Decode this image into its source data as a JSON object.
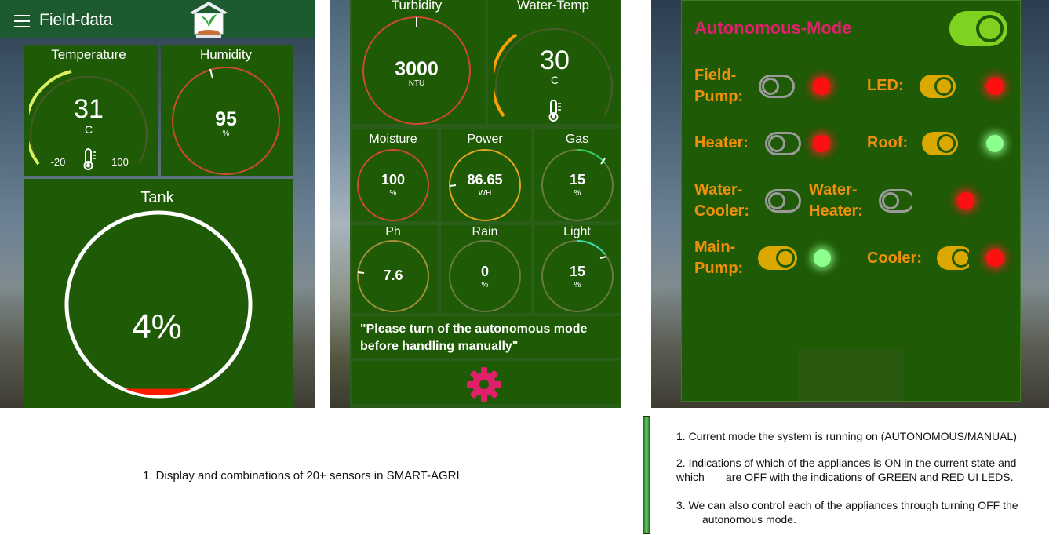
{
  "screen1": {
    "app_title": "Field-data",
    "temperature": {
      "label": "Temperature",
      "value": "31",
      "unit": "C",
      "min": "-20",
      "max": "100"
    },
    "humidity": {
      "label": "Humidity",
      "value": "95",
      "unit": "%"
    },
    "tank": {
      "label": "Tank",
      "value": "4%",
      "level": 0.04
    }
  },
  "screen2": {
    "turbidity": {
      "label": "Turbidity",
      "value": "3000",
      "unit": "NTU"
    },
    "water_temp": {
      "label": "Water-Temp",
      "value": "30",
      "unit": "C"
    },
    "moisture": {
      "label": "Moisture",
      "value": "100",
      "unit": "%"
    },
    "power": {
      "label": "Power",
      "value": "86.65",
      "unit": "WH"
    },
    "gas": {
      "label": "Gas",
      "value": "15",
      "unit": "%"
    },
    "ph": {
      "label": "Ph",
      "value": "7.6"
    },
    "rain": {
      "label": "Rain",
      "value": "0",
      "unit": "%"
    },
    "light": {
      "label": "Light",
      "value": "15",
      "unit": "%"
    },
    "notice": "\"Please turn of the autonomous mode before handling manually\"",
    "settings_icon": "gear-icon"
  },
  "screen3": {
    "autonomous_label": "Autonomous-Mode",
    "autonomous_on": true,
    "appliances": {
      "field_pump": {
        "label_1": "Field-",
        "label_2": "Pump:",
        "on": false,
        "led": "red"
      },
      "led": {
        "label": "LED:",
        "on": true,
        "led": "red"
      },
      "heater": {
        "label": "Heater:",
        "on": false,
        "led": "red"
      },
      "roof": {
        "label": "Roof:",
        "on": true,
        "led": "green"
      },
      "water_cooler": {
        "label_1": "Water-",
        "label_2": "Cooler:",
        "on": false
      },
      "water_heater": {
        "label_1": "Water-",
        "label_2": "Heater:",
        "on": false,
        "led": "red"
      },
      "main_pump": {
        "label_1": "Main-",
        "label_2": "Pump:",
        "on": true,
        "led": "green"
      },
      "cooler": {
        "label": "Cooler:",
        "on": true,
        "led": "red"
      }
    }
  },
  "captions": {
    "left": "1. Display and combinations of 20+ sensors in SMART-AGRI",
    "right_1": "1. Current mode the system is running on (AUTONOMOUS/MANUAL)",
    "right_2a": "2. Indications of which of the appliances is ON in the current state and",
    "right_2b": "which       are OFF with the indications of GREEN and RED UI LEDS.",
    "right_3a": "3. We can also control each of the appliances through turning OFF the",
    "right_3b": "autonomous mode."
  },
  "colors": {
    "panel_green": "#1f5a06",
    "accent_orange": "#f0900a",
    "mode_pink": "#e0206a",
    "toggle_on": "#dba800",
    "toggle_main_on": "#7fd320"
  }
}
